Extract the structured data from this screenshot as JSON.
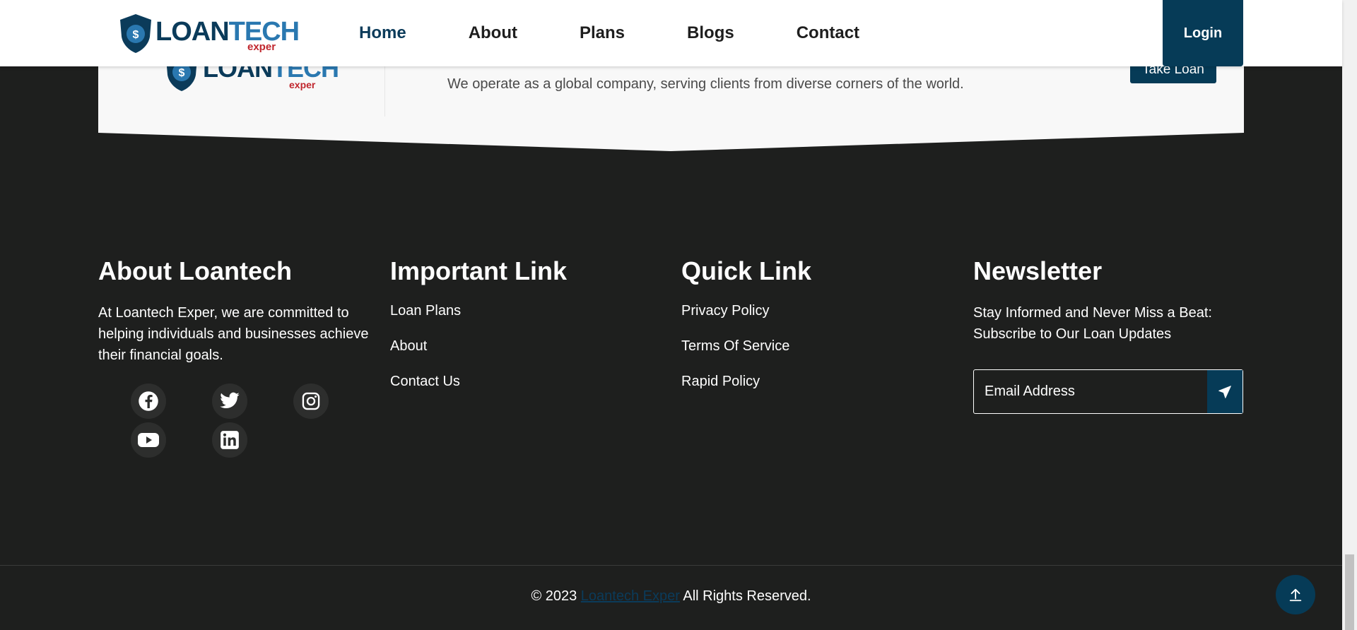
{
  "brand": {
    "word_part1": "LOAN",
    "word_part2": "TECH",
    "sub": "exper",
    "shield_symbol": "$"
  },
  "nav": {
    "items": [
      {
        "label": "Home",
        "active": true
      },
      {
        "label": "About"
      },
      {
        "label": "Plans"
      },
      {
        "label": "Blogs"
      },
      {
        "label": "Contact"
      }
    ],
    "login_label": "Login"
  },
  "cta": {
    "text": "We operate as a global company, serving clients from diverse corners of the world.",
    "button_label": "Take Loan"
  },
  "footer": {
    "about": {
      "title": "About Loantech",
      "text": "At Loantech Exper, we are committed to helping individuals and businesses achieve their financial goals.",
      "social": [
        "facebook-icon",
        "twitter-icon",
        "instagram-icon",
        "youtube-icon",
        "linkedin-icon"
      ]
    },
    "important": {
      "title": "Important Link",
      "links": [
        "Loan Plans",
        "About",
        "Contact Us"
      ]
    },
    "quick": {
      "title": "Quick Link",
      "links": [
        "Privacy Policy",
        "Terms Of Service",
        "Rapid Policy"
      ]
    },
    "newsletter": {
      "title": "Newsletter",
      "text": "Stay Informed and Never Miss a Beat: Subscribe to Our Loan Updates",
      "placeholder": "Email Address"
    },
    "copyright": {
      "prefix": "© 2023",
      "link": "Loantech Exper",
      "suffix": "All Rights Reserved."
    }
  },
  "colors": {
    "primary": "#063b57",
    "footer_bg": "#1e1f1e",
    "accent_red": "#c0262d"
  }
}
